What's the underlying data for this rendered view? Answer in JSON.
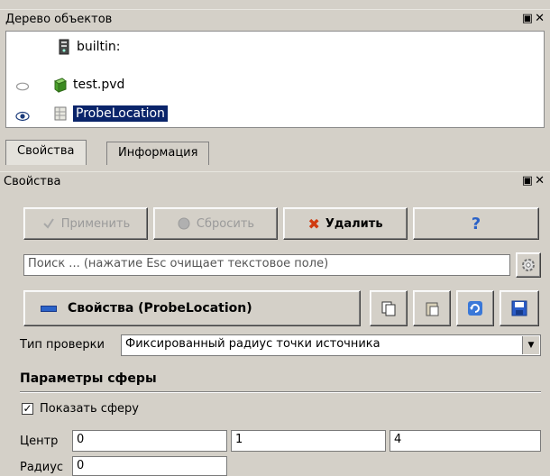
{
  "object_tree": {
    "title": "Дерево объектов",
    "items": [
      {
        "label": "builtin:",
        "eye": "none",
        "icon": "server-icon",
        "selected": false
      },
      {
        "label": "test.pvd",
        "eye": "closed",
        "icon": "dataset-icon",
        "selected": false
      },
      {
        "label": "ProbeLocation",
        "eye": "open",
        "icon": "filter-icon",
        "selected": true
      }
    ]
  },
  "tabs": {
    "properties": "Свойства",
    "information": "Информация"
  },
  "properties_panel": {
    "title": "Свойства",
    "apply_label": "Применить",
    "reset_label": "Сбросить",
    "delete_label": "Удалить",
    "help_label": "?",
    "search_placeholder": "Поиск ... (нажатие Esc очищает текстовое поле)",
    "section_title": "Свойства (ProbeLocation)",
    "probe_type_label": "Тип проверки",
    "probe_type_value": "Фиксированный радиус точки источника",
    "sphere_params_title": "Параметры сферы",
    "show_sphere_label": "Показать сферу",
    "show_sphere_checked": true,
    "center_label": "Центр",
    "center_values": [
      "0",
      "1",
      "4"
    ],
    "radius_label": "Радиус",
    "radius_value": "0"
  },
  "colors": {
    "panel_bg": "#d4d0c8",
    "selection": "#0a246a",
    "delete_x": "#d03a10",
    "help_blue": "#2a62c8"
  }
}
